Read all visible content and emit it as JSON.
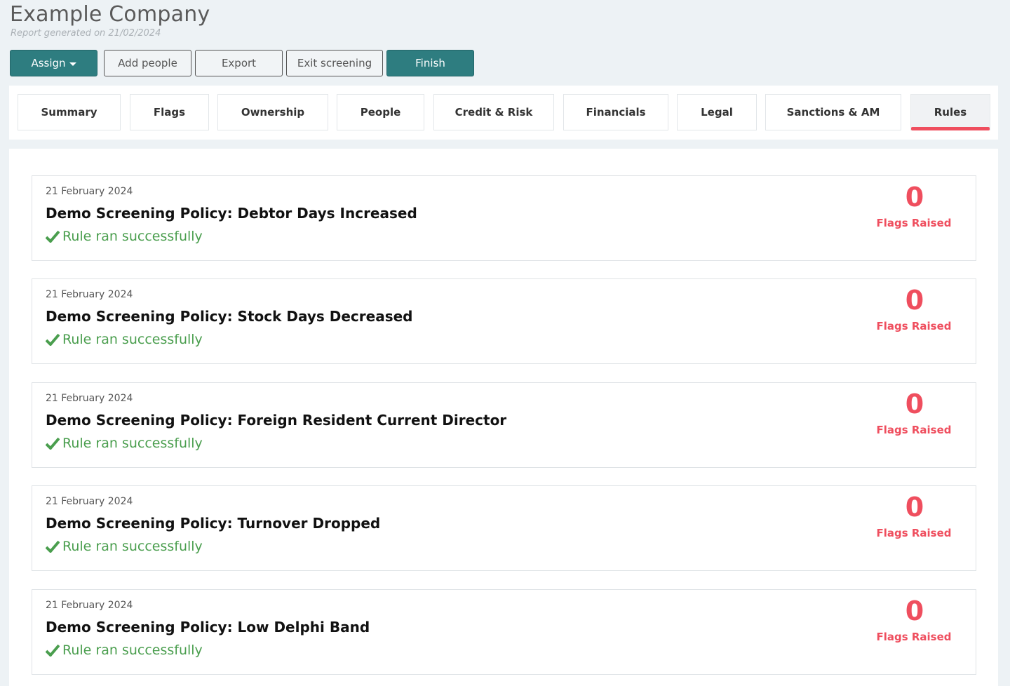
{
  "header": {
    "company_name": "Example Company",
    "report_generated": "Report generated on 21/02/2024"
  },
  "toolbar": {
    "assign_label": "Assign",
    "add_people_label": "Add people",
    "export_label": "Export",
    "exit_screening_label": "Exit screening",
    "finish_label": "Finish"
  },
  "tabs": [
    {
      "label": "Summary"
    },
    {
      "label": "Flags"
    },
    {
      "label": "Ownership"
    },
    {
      "label": "People"
    },
    {
      "label": "Credit & Risk"
    },
    {
      "label": "Financials"
    },
    {
      "label": "Legal"
    },
    {
      "label": "Sanctions & AM"
    },
    {
      "label": "Rules"
    }
  ],
  "active_tab": "Rules",
  "rules": [
    {
      "date": "21 February 2024",
      "title": "Demo Screening Policy: Debtor Days Increased",
      "status": "Rule ran successfully",
      "flags": "0",
      "flags_label": "Flags Raised"
    },
    {
      "date": "21 February 2024",
      "title": "Demo Screening Policy: Stock Days Decreased",
      "status": "Rule ran successfully",
      "flags": "0",
      "flags_label": "Flags Raised"
    },
    {
      "date": "21 February 2024",
      "title": "Demo Screening Policy: Foreign Resident Current Director",
      "status": "Rule ran successfully",
      "flags": "0",
      "flags_label": "Flags Raised"
    },
    {
      "date": "21 February 2024",
      "title": "Demo Screening Policy: Turnover Dropped",
      "status": "Rule ran successfully",
      "flags": "0",
      "flags_label": "Flags Raised"
    },
    {
      "date": "21 February 2024",
      "title": "Demo Screening Policy: Low Delphi Band",
      "status": "Rule ran successfully",
      "flags": "0",
      "flags_label": "Flags Raised"
    }
  ],
  "colors": {
    "primary": "#2e7d80",
    "flag_red": "#ef4e5e",
    "success_green": "#4a9e4e",
    "background": "#edf2f5"
  },
  "icons": {
    "assign_caret": "caret-down-icon",
    "status": "check-icon"
  }
}
